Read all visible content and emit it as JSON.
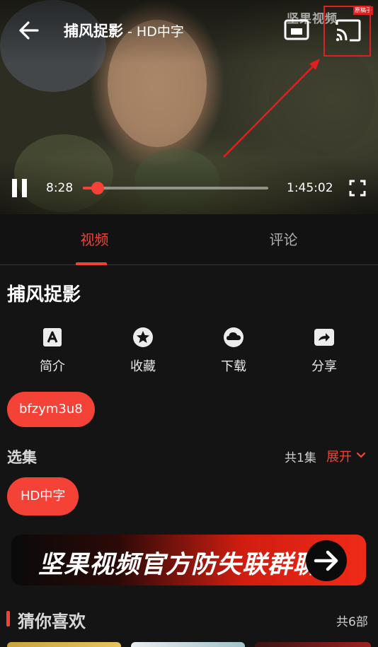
{
  "player": {
    "title": "捕风捉影",
    "subtitle": " - HD中字",
    "time_current": "8:28",
    "time_total": "1:45:02",
    "progress_fraction": 0.081,
    "watermark": "坚果视频",
    "watermark_tag": "原稿子",
    "icons": {
      "back": "arrow-left-icon",
      "pip": "picture-in-picture-icon",
      "cast": "cast-icon",
      "pause": "pause-icon",
      "fullscreen": "fullscreen-icon"
    }
  },
  "tabs": [
    {
      "label": "视频",
      "active": true
    },
    {
      "label": "评论",
      "active": false
    }
  ],
  "show": {
    "title": "捕风捉影",
    "actions": [
      {
        "label": "简介",
        "icon": "info-icon"
      },
      {
        "label": "收藏",
        "icon": "star-icon"
      },
      {
        "label": "下载",
        "icon": "cloud-download-icon"
      },
      {
        "label": "分享",
        "icon": "share-icon"
      }
    ],
    "tag": "bfzym3u8"
  },
  "episodes": {
    "section_title": "选集",
    "count": "共1集",
    "expand_label": "展开",
    "items": [
      "HD中字"
    ]
  },
  "banner": {
    "text": "坚果视频官方防失联群聊"
  },
  "recommend": {
    "title": "猜你喜欢",
    "count": "共6部"
  },
  "colors": {
    "accent": "#f44336",
    "background": "#141414",
    "annotation": "#e02020"
  }
}
